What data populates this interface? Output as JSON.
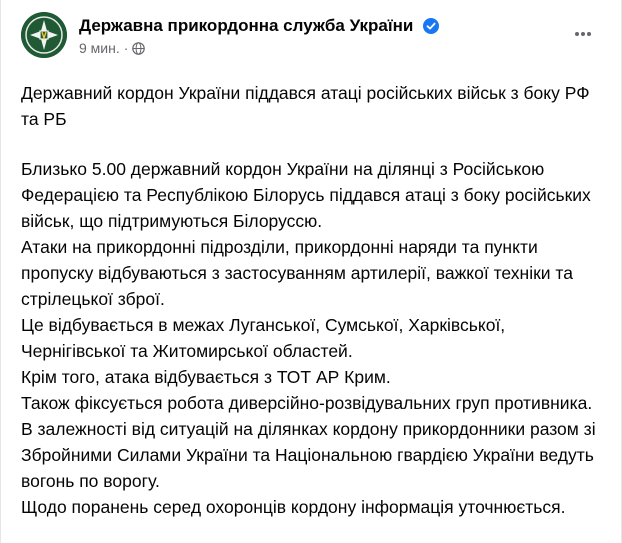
{
  "post": {
    "page_name": "Державна прикордонна служба України",
    "time": "9 мин.",
    "separator": "·",
    "headline": "Державний кордон України піддався атаці російських військ з боку РФ та РБ",
    "paragraphs": [
      "Близько 5.00 державний кордон України на ділянці з Російською Федерацією та Республікою Білорусь піддався атаці з боку російських військ, що підтримуються Білоруссю.",
      "Атаки на прикордонні підрозділи, прикордонні наряди та пункти пропуску відбуваються з застосуванням артилерії, важкої техніки та стрілецької зброї.",
      "Це відбувається в межах Луганської, Сумської, Харківської, Чернігівської та Житомирської областей.",
      "Крім того, атака відбувається з ТОТ АР Крим.",
      "Також фіксується робота диверсійно-розвідувальних груп противника.",
      "В залежності від ситуацій на ділянках кордону прикордонники разом зі Збройними Силами України та Національною гвардією України ведуть вогонь по ворогу.",
      "Щодо поранень серед охоронців кордону інформація уточнюється."
    ]
  },
  "icons": {
    "avatar": "border-guard-emblem-icon",
    "verified": "verified-badge-icon",
    "privacy": "globe-icon",
    "more": "more-horizontal-icon"
  },
  "colors": {
    "verified": "#1877f2",
    "avatar_bg": "#1f5a34",
    "meta_text": "#65676b"
  }
}
